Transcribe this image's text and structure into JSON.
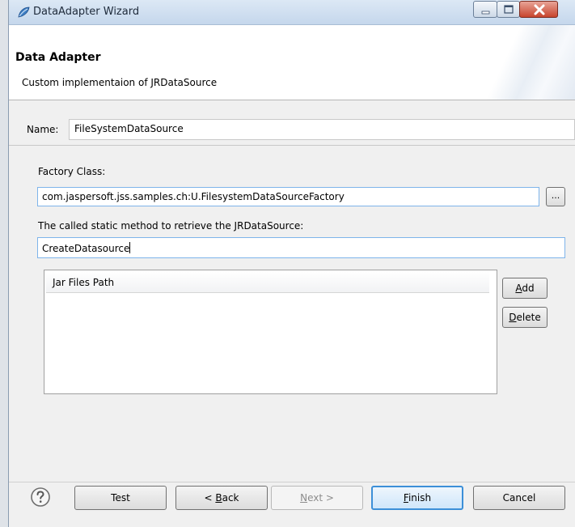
{
  "window": {
    "title": "DataAdapter Wizard",
    "icon": "jaspersoft-leaf-icon",
    "controls": [
      "minimize-icon",
      "maximize-icon",
      "close-icon"
    ]
  },
  "header": {
    "title": "Data Adapter",
    "description": "Custom implementaion of JRDataSource"
  },
  "name_row": {
    "label": "Name:",
    "value": "FileSystemDataSource"
  },
  "factory": {
    "label": "Factory Class:",
    "value": "com.jaspersoft.jss.samples.ch:U.FilesystemDataSourceFactory",
    "browse_label": "..."
  },
  "method": {
    "label": "The called static method to retrieve the JRDataSource:",
    "value": "CreateDatasource"
  },
  "jar_table": {
    "column_header": "Jar Files Path",
    "rows": []
  },
  "side_buttons": {
    "add_mnemonic": "A",
    "add_rest": "dd",
    "delete_mnemonic": "D",
    "delete_rest": "elete"
  },
  "footer": {
    "help_icon": "question-mark-icon",
    "test_label": "Test",
    "back_prefix": "< ",
    "back_mnemonic": "B",
    "back_rest": "ack",
    "next_mnemonic": "N",
    "next_rest": "ext >",
    "finish_mnemonic": "F",
    "finish_rest": "inish",
    "cancel_label": "Cancel"
  },
  "colors": {
    "focus_border": "#7eb4ea",
    "default_button": "#3c8fd8",
    "dialog_bg": "#f0f0f0"
  }
}
